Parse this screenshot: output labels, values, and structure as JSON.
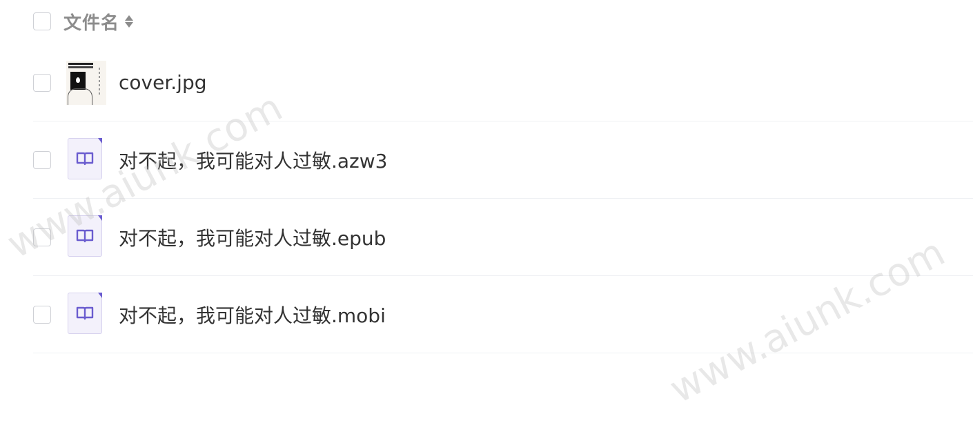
{
  "header": {
    "column_label": "文件名"
  },
  "files": [
    {
      "name": "cover.jpg",
      "icon": "image-thumbnail-icon"
    },
    {
      "name": "对不起，我可能对人过敏.azw3",
      "icon": "ebook-icon"
    },
    {
      "name": "对不起，我可能对人过敏.epub",
      "icon": "ebook-icon"
    },
    {
      "name": "对不起，我可能对人过敏.mobi",
      "icon": "ebook-icon"
    }
  ],
  "watermark": "www.aiunk.com",
  "colors": {
    "ebook_accent": "#6a5ccf",
    "divider": "#eef0f3"
  }
}
